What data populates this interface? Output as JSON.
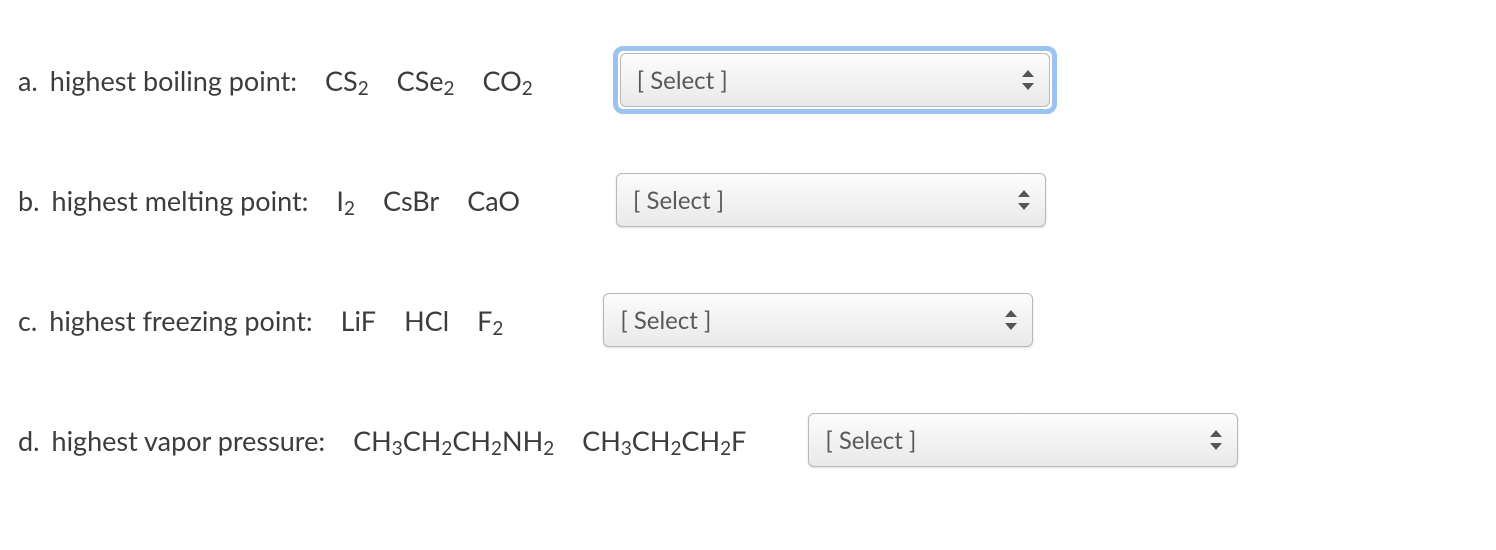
{
  "questions": {
    "a": {
      "letter": "a.",
      "label": "highest boiling point:",
      "formulas": [
        "CS₂",
        "CSe₂",
        "CO₂"
      ],
      "select_value": "[ Select ]",
      "focused": true
    },
    "b": {
      "letter": "b.",
      "label": "highest melting point:",
      "formulas": [
        "I₂",
        "CsBr",
        "CaO"
      ],
      "select_value": "[ Select ]",
      "focused": false
    },
    "c": {
      "letter": "c.",
      "label": "highest freezing point:",
      "formulas": [
        "LiF",
        "HCl",
        "F₂"
      ],
      "select_value": "[ Select ]",
      "focused": false
    },
    "d": {
      "letter": "d.",
      "label": "highest vapor pressure:",
      "formulas": [
        "CH₃CH₂CH₂NH₂",
        "CH₃CH₂CH₂F"
      ],
      "select_value": "[ Select ]",
      "focused": false
    }
  }
}
